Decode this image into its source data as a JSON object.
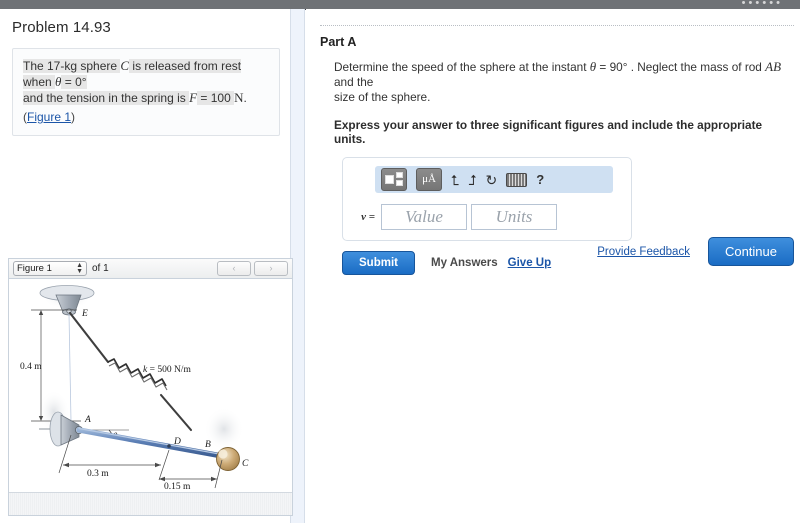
{
  "top_bar": {
    "faint_text": "• • • • • •"
  },
  "left": {
    "problem_title": "Problem 14.93",
    "statement": {
      "line1_a": "The 17-kg sphere ",
      "line1_sym": "C",
      "line1_b": " is released from rest when ",
      "line1_theta": "θ",
      "line1_eq": " = 0",
      "line1_deg": "°",
      "line2_a": "and the tension in the spring is ",
      "line2_f": "F",
      "line2_b": " = 100 ",
      "line2_n": "N",
      "line2_end": ".",
      "figure_link": "Figure 1",
      "paren_open": "(",
      "paren_close": ")"
    }
  },
  "figure_panel": {
    "select_value": "Figure 1",
    "of_label": "of 1",
    "prev_label": "‹",
    "next_label": "›",
    "diagram": {
      "label_E": "E",
      "label_A": "A",
      "label_B": "B",
      "label_C": "C",
      "label_D": "D",
      "label_theta": "θ",
      "dim_vertical": "0.4 m",
      "dim_horizontal_1": "0.3 m",
      "dim_horizontal_2": "0.15 m",
      "spring_label_k": "k",
      "spring_label_val": " = 500 N/m"
    }
  },
  "right": {
    "part_title": "Part A",
    "question_a": "Determine the speed of the sphere at the instant ",
    "question_theta": "θ",
    "question_b": " = 90",
    "question_deg": "°",
    "question_c": " . Neglect the mass of rod ",
    "question_rod": "AB",
    "question_d": " and the",
    "question_line2": "size of the sphere.",
    "emphasis": "Express your answer to three significant figures and include the appropriate units.",
    "answer": {
      "variable": "v =",
      "value_placeholder": "Value",
      "units_placeholder": "Units",
      "toolbar": {
        "template_icon": "template-icon",
        "units_icon": "μÅ",
        "undo_icon": "⮤",
        "redo_icon": "⮥",
        "reset_icon": "↻",
        "keyboard_icon": "keyboard-icon",
        "help_icon": "?"
      }
    },
    "submit_label": "Submit",
    "my_answers_label": "My Answers",
    "give_up_label": "Give Up",
    "provide_feedback_label": "Provide Feedback",
    "continue_label": "Continue"
  },
  "colors": {
    "accent_blue": "#1a6cc4",
    "link_blue": "#1b55a8",
    "toolbar_blue": "#cfe0f2",
    "divider": "#eef3fb"
  }
}
